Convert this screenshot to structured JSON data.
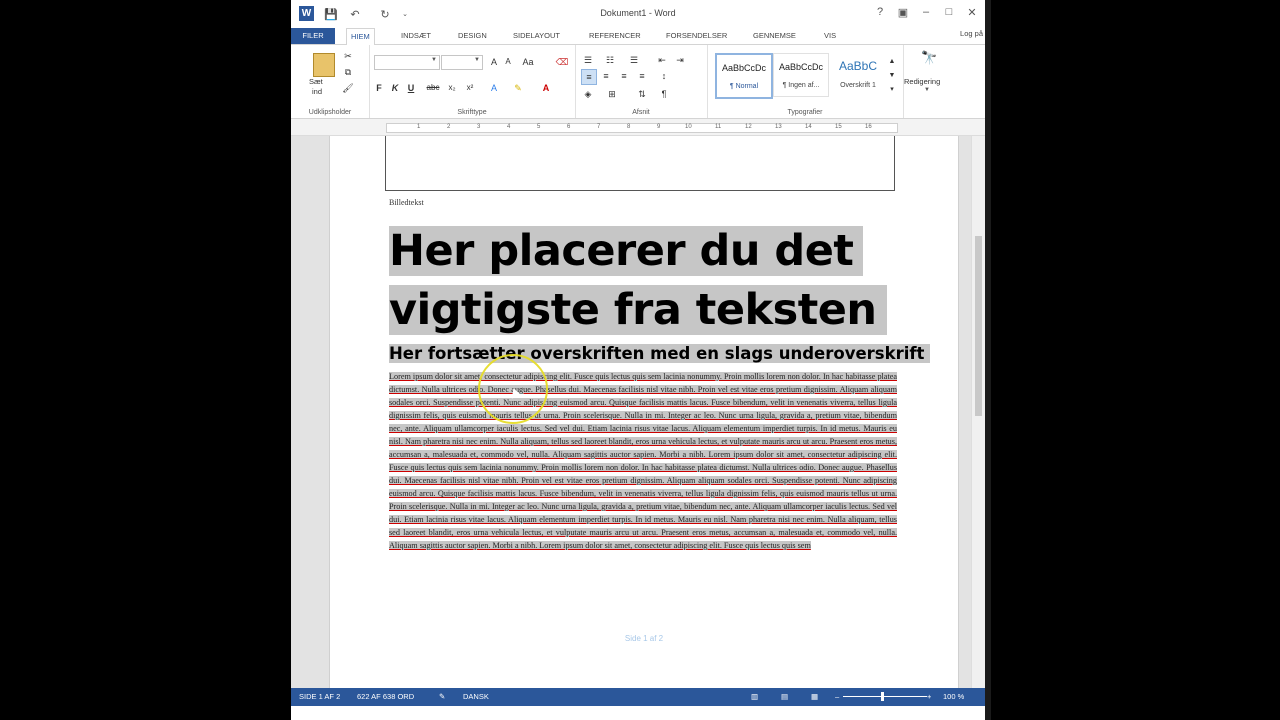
{
  "window": {
    "title": "Dokument1 - Word",
    "help_icon": "?",
    "ribbon_display_icon": "ribbon-display-icon",
    "minimize_icon": "minimize-icon",
    "maximize_icon": "maximize-icon",
    "close_icon": "close-icon"
  },
  "quick_access": {
    "logo": "W",
    "save_icon": "save-icon",
    "undo_icon": "undo-icon",
    "redo_icon": "redo-icon"
  },
  "tabs": [
    {
      "label": "FILER"
    },
    {
      "label": "HIEM"
    },
    {
      "label": "INDSÆT"
    },
    {
      "label": "DESIGN"
    },
    {
      "label": "SIDELAYOUT"
    },
    {
      "label": "REFERENCER"
    },
    {
      "label": "FORSENDELSER"
    },
    {
      "label": "GENNEMSE"
    },
    {
      "label": "VIS"
    }
  ],
  "signin": "Log på",
  "ribbon": {
    "clipboard": {
      "paste_label": "Sæt",
      "paste_label2": "ind",
      "group": "Udklipsholder"
    },
    "font": {
      "group": "Skrifttype",
      "bold": "F",
      "italic": "K",
      "underline": "U",
      "strike": "abc"
    },
    "paragraph": {
      "group": "Afsnit"
    },
    "styles": {
      "group": "Typografier",
      "tiles": [
        {
          "preview": "AaBbCcDc",
          "name": "¶ Normal"
        },
        {
          "preview": "AaBbCcDc",
          "name": "¶ Ingen af..."
        },
        {
          "preview": "AaBbC",
          "name": "Overskrift 1"
        }
      ]
    },
    "editing": {
      "label": "Redigering"
    }
  },
  "document": {
    "caption": "Billedtekst",
    "headline_line1": "Her placerer du det",
    "headline_line2": "vigtigste fra teksten",
    "subheadline": "Her fortsætter overskriften med en slags underoverskrift",
    "body": "Lorem ipsum dolor sit amet, consectetur adipiscing elit. Fusce quis lectus quis sem lacinia nonummy. Proin mollis lorem non dolor. In hac habitasse platea dictumst. Nulla ultrices odio. Donec augue. Phasellus dui. Maecenas facilisis nisl vitae nibh. Proin vel est vitae eros pretium dignissim. Aliquam aliquam sodales orci. Suspendisse potenti. Nunc adipiscing euismod arcu. Quisque facilisis mattis lacus. Fusce bibendum, velit in venenatis viverra, tellus ligula dignissim felis, quis euismod mauris tellus ut urna. Proin scelerisque. Nulla in mi. Integer ac leo. Nunc urna ligula, gravida a, pretium vitae, bibendum nec, ante. Aliquam ullamcorper iaculis lectus. Sed vel dui. Etiam lacinia risus vitae lacus. Aliquam elementum imperdiet turpis. In id metus. Mauris eu nisl. Nam pharetra nisi nec enim. Nulla aliquam, tellus sed laoreet blandit, eros urna vehicula lectus, et vulputate mauris arcu ut arcu. Praesent eros metus, accumsan a, malesuada et, commodo vel, nulla. Aliquam sagittis auctor sapien. Morbi a nibh. Lorem ipsum dolor sit amet, consectetur adipiscing elit. Fusce quis lectus quis sem lacinia nonummy. Proin mollis lorem non dolor. In hac habitasse platea dictumst. Nulla ultrices odio. Donec augue. Phasellus dui. Maecenas facilisis nisl vitae nibh. Proin vel est vitae eros pretium dignissim. Aliquam aliquam sodales orci. Suspendisse potenti. Nunc adipiscing euismod arcu. Quisque facilisis mattis lacus. Fusce bibendum, velit in venenatis viverra, tellus ligula dignissim felis, quis euismod mauris tellus ut urna. Proin scelerisque. Nulla in mi. Integer ac leo. Nunc urna ligula, gravida a, pretium vitae, bibendum nec, ante. Aliquam ullamcorper iaculis lectus. Sed vel dui. Etiam lacinia risus vitae lacus. Aliquam elementum imperdiet turpis. In id metus. Mauris eu nisl. Nam pharetra nisi nec enim. Nulla aliquam, tellus sed laoreet blandit, eros urna vehicula lectus, et vulputate mauris arcu ut arcu. Praesent eros metus, accumsan a, malesuada et, commodo vel, nulla. Aliquam sagittis auctor sapien. Morbi a nibh. Lorem ipsum dolor sit amet, consectetur adipiscing elit. Fusce quis lectus quis sem",
    "page_footer": "Side 1 af 2"
  },
  "status": {
    "page": "SIDE 1 AF 2",
    "words": "622 AF 638 ORD",
    "language": "DANSK",
    "zoom": "100 %"
  },
  "colors": {
    "accent": "#2b579a",
    "selection": "#c6c6c6",
    "pen": "#e6dc28"
  }
}
